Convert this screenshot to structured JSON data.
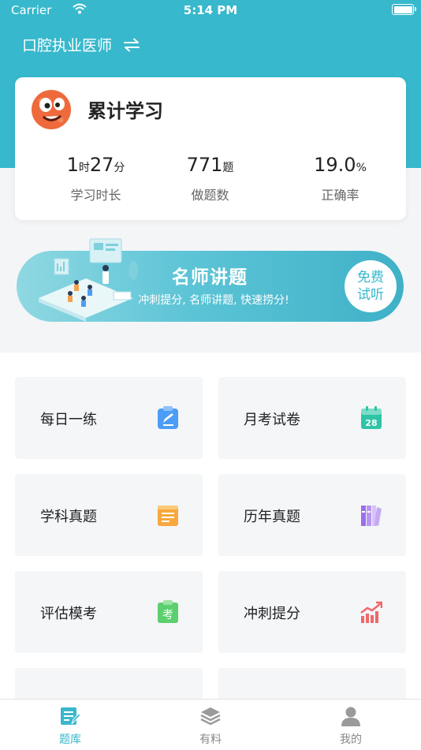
{
  "status_bar": {
    "carrier": "Carrier",
    "time": "5:14 PM"
  },
  "header": {
    "subject": "口腔执业医师"
  },
  "stats_card": {
    "title": "累计学习",
    "study_time": {
      "hours": "1",
      "hours_unit": "时",
      "minutes": "27",
      "minutes_unit": "分",
      "label": "学习时长"
    },
    "questions_done": {
      "value": "771",
      "unit": "题",
      "label": "做题数"
    },
    "accuracy": {
      "value": "19.0",
      "unit": "%",
      "label": "正确率"
    }
  },
  "banner": {
    "title": "名师讲题",
    "subtitle": "冲刺提分, 名师讲题, 快速捞分!",
    "free_button_line1": "免费",
    "free_button_line2": "试听"
  },
  "tiles": [
    {
      "label": "每日一练",
      "icon": "edit-note-icon",
      "color": "#4c9df5"
    },
    {
      "label": "月考试卷",
      "icon": "calendar-28-icon",
      "color": "#2ec4a6",
      "badge": "28"
    },
    {
      "label": "学科真题",
      "icon": "notepad-icon",
      "color": "#f7a83e"
    },
    {
      "label": "历年真题",
      "icon": "books-icon",
      "color": "#9b6fe8"
    },
    {
      "label": "评估模考",
      "icon": "exam-icon",
      "color": "#5ccf6e",
      "badge": "考"
    },
    {
      "label": "冲刺提分",
      "icon": "trend-chart-icon",
      "color": "#f0686a"
    }
  ],
  "tabbar": {
    "items": [
      {
        "label": "题库",
        "active": true
      },
      {
        "label": "有料",
        "active": false
      },
      {
        "label": "我的",
        "active": false
      }
    ]
  },
  "colors": {
    "primary": "#37b8cc",
    "text": "#222222",
    "muted": "#666666",
    "tile_bg": "#f4f6f8"
  }
}
